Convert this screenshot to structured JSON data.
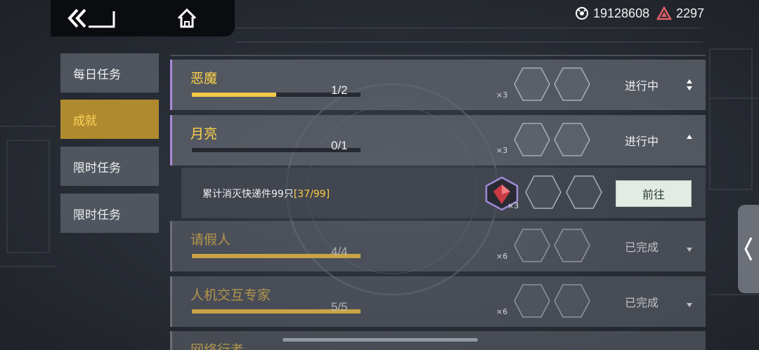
{
  "header": {
    "back_icon": "double-chevron-back-icon",
    "home_icon": "home-icon",
    "currencies": [
      {
        "icon": "gene-coin-icon",
        "value": "19128608"
      },
      {
        "icon": "red-triangle-gem-icon",
        "value": "2297",
        "color": "#e0616a"
      }
    ]
  },
  "sidebar": {
    "items": [
      {
        "label": "每日任务",
        "active": false
      },
      {
        "label": "成就",
        "active": true
      },
      {
        "label": "限时任务",
        "active": false
      },
      {
        "label": "限时任务",
        "active": false
      }
    ]
  },
  "quests": [
    {
      "title": "恶魔",
      "progress": "1/2",
      "fraction": 0.5,
      "reward_multiplier": "×3",
      "status": "进行中",
      "done": false
    },
    {
      "title": "月亮",
      "progress": "0/1",
      "fraction": 0.0,
      "reward_multiplier": "×3",
      "status": "进行中",
      "done": false,
      "expanded": true
    },
    {
      "title": "请假人",
      "progress": "4/4",
      "fraction": 1.0,
      "reward_multiplier": "×6",
      "status": "已完成",
      "done": true
    },
    {
      "title": "人机交互专家",
      "progress": "5/5",
      "fraction": 1.0,
      "reward_multiplier": "×6",
      "status": "已完成",
      "done": true
    },
    {
      "title": "网络行者",
      "done": true
    }
  ],
  "sub_objective": {
    "text": "累计消灭快递件99只",
    "count": "[37/99]",
    "reward_multiplier": "×3",
    "reward_icon": "red-crystal-reward-icon",
    "button_label": "前往"
  },
  "colors": {
    "accent_yellow": "#ffd24a",
    "accent_purple": "#a98ad8",
    "active_tab": "#b08a2e"
  }
}
